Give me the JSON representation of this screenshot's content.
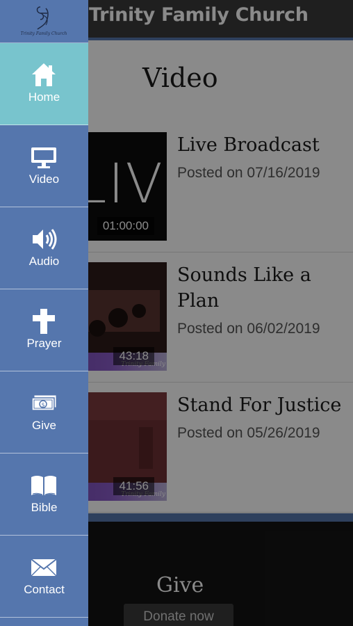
{
  "app": {
    "title": "Trinity Family Church"
  },
  "page": {
    "title": "Video"
  },
  "logo": {
    "text": "Trinity Family Church",
    "icon": "church-logo"
  },
  "videos": [
    {
      "title": "Live Broadcast",
      "posted": "Posted on 07/16/2019",
      "duration": "01:00:00",
      "thumb_text": "LIVE"
    },
    {
      "title": "Sounds Like a Plan",
      "posted": "Posted on 06/02/2019",
      "duration": "43:18",
      "thumb_text": "Trinity Family"
    },
    {
      "title": "Stand For Justice",
      "posted": "Posted on 05/26/2019",
      "duration": "41:56",
      "thumb_text": "Trinity Family"
    }
  ],
  "footer": {
    "give_heading": "Give",
    "donate_label": "Donate now"
  },
  "drawer": {
    "items": [
      {
        "label": "Home",
        "icon": "home-icon",
        "active": true
      },
      {
        "label": "Video",
        "icon": "monitor-icon",
        "active": false
      },
      {
        "label": "Audio",
        "icon": "speaker-icon",
        "active": false
      },
      {
        "label": "Prayer",
        "icon": "cross-icon",
        "active": false
      },
      {
        "label": "Give",
        "icon": "money-icon",
        "active": false
      },
      {
        "label": "Bible",
        "icon": "book-icon",
        "active": false
      },
      {
        "label": "Contact",
        "icon": "envelope-icon",
        "active": false
      }
    ]
  },
  "colors": {
    "drawer": "#5576ad",
    "active_item": "#78c4cd",
    "topbar": "#3a3a3a"
  }
}
